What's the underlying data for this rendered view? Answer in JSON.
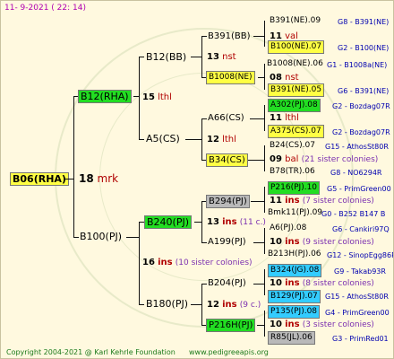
{
  "header": {
    "date": "11-  9-2021  ( 22:  14)"
  },
  "colors": {
    "yellow": "#ffff44",
    "green": "#22dd22",
    "gray": "#b9b9b9",
    "cyan": "#33ccff",
    "bg": "#fff9df"
  },
  "gen1": {
    "code": "B06(RHA)",
    "num": "18",
    "mark": "mrk"
  },
  "gen2": [
    {
      "code": "B12(RHA)",
      "num": "15",
      "mark": "lthl"
    },
    {
      "code": "B100(PJ)",
      "num": "16",
      "mark": "ins",
      "note": "(10 sister colonies)"
    }
  ],
  "gen3": [
    {
      "code": "B12(BB)",
      "num": "13",
      "mark": "nst"
    },
    {
      "code": "A5(CS)",
      "num": "12",
      "mark": "lthl"
    },
    {
      "code": "B240(PJ)",
      "num": "13",
      "mark": "ins",
      "note": "(11 c.)"
    },
    {
      "code": "B180(PJ)",
      "num": "12",
      "mark": "ins",
      "note": "(9 c.)"
    }
  ],
  "gen4": [
    {
      "code": "B391(BB)",
      "num": "11",
      "mark": "val"
    },
    {
      "code": "B1008(NE)",
      "num": "08",
      "mark": "nst"
    },
    {
      "code": "A66(CS)",
      "num": "11",
      "mark": "lthl"
    },
    {
      "code": "B34(CS)",
      "num": "09",
      "mark": "bal",
      "note": "(21 sister colonies)"
    },
    {
      "code": "B294(PJ)",
      "num": "11",
      "mark": "ins",
      "note": "(7 sister colonies)"
    },
    {
      "code": "A199(PJ)",
      "num": "10",
      "mark": "ins",
      "note": "(9 sister colonies)"
    },
    {
      "code": "B204(PJ)",
      "num": "10",
      "mark": "ins",
      "note": "(8 sister colonies)"
    },
    {
      "code": "P216H(PJ)",
      "num": "10",
      "mark": "ins",
      "note": "(3 sister colonies)"
    }
  ],
  "gen5": [
    {
      "code": "B391(NE).09",
      "src": "G8 - B391(NE)"
    },
    {
      "code": "B100(NE).07",
      "src": "G2 - B100(NE)"
    },
    {
      "code": "B1008(NE).06",
      "src": "G1 - B1008a(NE)"
    },
    {
      "code": "B391(NE).05",
      "src": "G6 - B391(NE)"
    },
    {
      "code": "A302(PJ).08",
      "src": "G2 - Bozdag07R"
    },
    {
      "code": "A375(CS).07",
      "src": "G2 - Bozdag07R"
    },
    {
      "code": "B24(CS).07",
      "src": "G15 - AthosSt80R"
    },
    {
      "code": "B78(TR).06",
      "src": "G8 - NO6294R"
    },
    {
      "code": "P216(PJ).10",
      "src": "G5 - PrimGreen00"
    },
    {
      "code": "Bmk11(PJ).09",
      "src": "G0 - B252 B147 B"
    },
    {
      "code": "A6(PJ).08",
      "src": "G6 - Cankiri97Q"
    },
    {
      "code": "B213H(PJ).06",
      "src": "G12 - SinopEgg86R"
    },
    {
      "code": "B324(JG).08",
      "src": "G9 - Takab93R"
    },
    {
      "code": "B129(PJ).07",
      "src": "G15 - AthosSt80R"
    },
    {
      "code": "P135(PJ).08",
      "src": "G4 - PrimGreen00"
    },
    {
      "code": "R85(JL).06",
      "src": "G3 - PrimRed01"
    }
  ],
  "footer": {
    "copyright": "Copyright 2004-2021 @ Karl Kehrle Foundation",
    "url": "www.pedigreeapis.org"
  }
}
